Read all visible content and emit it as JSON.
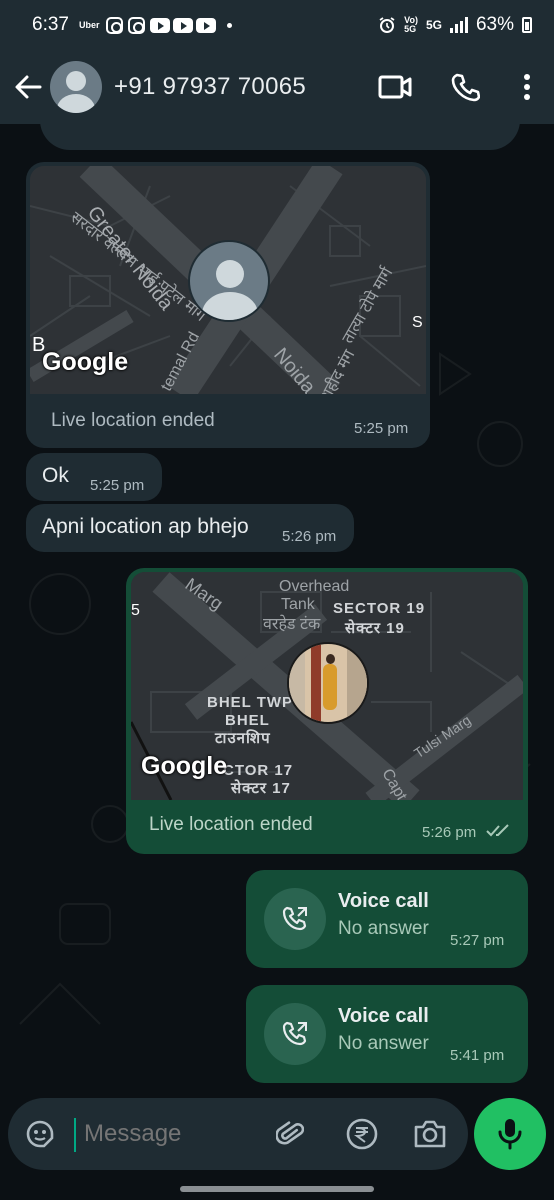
{
  "status_bar": {
    "time": "6:37",
    "uber_label": "Uber",
    "network_label_top": "Vo)",
    "network_label_bottom": "5G",
    "fiveg_label": "5G",
    "battery": "63%"
  },
  "header": {
    "contact": "+91 97937 70065",
    "icons": [
      "back-arrow-icon",
      "video-call-icon",
      "voice-call-icon",
      "more-options-icon"
    ]
  },
  "messages": {
    "map1": {
      "labels": [
        "Greater Noida",
        "सरदार वल्लभ भाई पटेल मार्ग",
        "Noida",
        "तात्या टोपे मार्ग",
        "शहीद मंग",
        "temal Rd",
        "B",
        "S"
      ],
      "google": "Google",
      "status": "Live location ended",
      "time": "5:25 pm"
    },
    "ok": {
      "text": "Ok",
      "time": "5:25 pm"
    },
    "apni": {
      "text": "Apni location ap bhejo",
      "time": "5:26 pm"
    },
    "map2": {
      "labels": [
        "Marg",
        "Overhead",
        "Tank",
        "वरहेड टंक",
        "SECTOR 19",
        "सेक्टर 19",
        "BHEL TWP",
        "BHEL",
        "टाउनशिप",
        "CTOR 17",
        "सेक्टर 17",
        "Tulsi Marg",
        "Capt",
        "5"
      ],
      "google": "Google",
      "status": "Live location ended",
      "time": "5:26 pm"
    },
    "call1": {
      "title": "Voice call",
      "subtitle": "No answer",
      "time": "5:27 pm"
    },
    "call2": {
      "title": "Voice call",
      "subtitle": "No answer",
      "time": "5:41 pm"
    }
  },
  "input": {
    "placeholder": "Message",
    "icons": [
      "emoji-sticker-icon",
      "attach-icon",
      "rupee-payment-icon",
      "camera-icon",
      "mic-icon"
    ]
  },
  "colors": {
    "header_bg": "#1f2c33",
    "incoming_bubble": "#1f2c33",
    "outgoing_bubble": "#144d37",
    "accent_green": "#21c063",
    "chat_bg": "#0b1014"
  }
}
